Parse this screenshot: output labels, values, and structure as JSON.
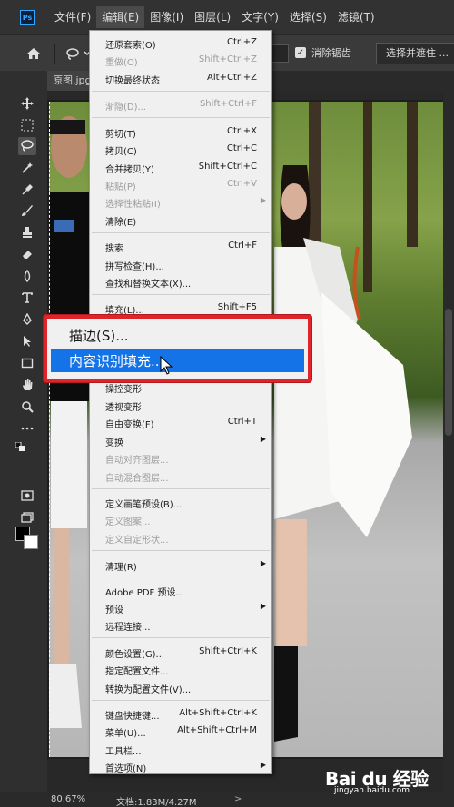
{
  "menubar": {
    "logo": "Ps",
    "items": [
      "文件(F)",
      "编辑(E)",
      "图像(I)",
      "图层(L)",
      "文字(Y)",
      "选择(S)",
      "滤镜(T)"
    ]
  },
  "options": {
    "antialias_label": "消除锯齿",
    "select_mask_label": "选择并遮住 ..."
  },
  "tab": {
    "label": "原图.jpg"
  },
  "status": {
    "zoom": "80.67%",
    "doc": "文档:1.83M/4.27M",
    "arrow": ">"
  },
  "menu": {
    "items": [
      {
        "label": "还原套索(O)",
        "shortcut": "Ctrl+Z",
        "disabled": false
      },
      {
        "label": "重做(O)",
        "shortcut": "Shift+Ctrl+Z",
        "disabled": true
      },
      {
        "label": "切换最终状态",
        "shortcut": "Alt+Ctrl+Z",
        "disabled": false
      },
      {
        "label": "渐隐(D)...",
        "shortcut": "Shift+Ctrl+F",
        "disabled": true
      },
      {
        "label": "剪切(T)",
        "shortcut": "Ctrl+X",
        "disabled": false
      },
      {
        "label": "拷贝(C)",
        "shortcut": "Ctrl+C",
        "disabled": false
      },
      {
        "label": "合并拷贝(Y)",
        "shortcut": "Shift+Ctrl+C",
        "disabled": false
      },
      {
        "label": "粘贴(P)",
        "shortcut": "Ctrl+V",
        "disabled": true
      },
      {
        "label": "选择性粘贴(I)",
        "shortcut": "",
        "disabled": true
      },
      {
        "label": "清除(E)",
        "shortcut": "",
        "disabled": false
      },
      {
        "label": "搜索",
        "shortcut": "Ctrl+F",
        "disabled": false
      },
      {
        "label": "拼写检查(H)...",
        "shortcut": "",
        "disabled": false
      },
      {
        "label": "查找和替换文本(X)...",
        "shortcut": "",
        "disabled": false
      },
      {
        "label": "填充(L)...",
        "shortcut": "Shift+F5",
        "disabled": false
      },
      {
        "label": "描边(S)...",
        "shortcut": "",
        "disabled": false
      },
      {
        "label": "内容识别填充...",
        "shortcut": "",
        "disabled": false
      },
      {
        "label": "操控变形",
        "shortcut": "",
        "disabled": false
      },
      {
        "label": "透视变形",
        "shortcut": "",
        "disabled": false
      },
      {
        "label": "自由变换(F)",
        "shortcut": "Ctrl+T",
        "disabled": false
      },
      {
        "label": "变换",
        "shortcut": "",
        "disabled": false
      },
      {
        "label": "自动对齐图层...",
        "shortcut": "",
        "disabled": true
      },
      {
        "label": "自动混合图层...",
        "shortcut": "",
        "disabled": true
      },
      {
        "label": "定义画笔预设(B)...",
        "shortcut": "",
        "disabled": false
      },
      {
        "label": "定义图案...",
        "shortcut": "",
        "disabled": true
      },
      {
        "label": "定义自定形状...",
        "shortcut": "",
        "disabled": true
      },
      {
        "label": "清理(R)",
        "shortcut": "",
        "disabled": false
      },
      {
        "label": "Adobe PDF 预设...",
        "shortcut": "",
        "disabled": false
      },
      {
        "label": "预设",
        "shortcut": "",
        "disabled": false
      },
      {
        "label": "远程连接...",
        "shortcut": "",
        "disabled": false
      },
      {
        "label": "颜色设置(G)...",
        "shortcut": "Shift+Ctrl+K",
        "disabled": false
      },
      {
        "label": "指定配置文件...",
        "shortcut": "",
        "disabled": false
      },
      {
        "label": "转换为配置文件(V)...",
        "shortcut": "",
        "disabled": false
      },
      {
        "label": "键盘快捷键...",
        "shortcut": "Alt+Shift+Ctrl+K",
        "disabled": false
      },
      {
        "label": "菜单(U)...",
        "shortcut": "Alt+Shift+Ctrl+M",
        "disabled": false
      },
      {
        "label": "工具栏...",
        "shortcut": "",
        "disabled": false
      },
      {
        "label": "首选项(N)",
        "shortcut": "",
        "disabled": false
      }
    ]
  },
  "watermark": {
    "brand": "Bai du 经验",
    "url": "jingyan.baidu.com"
  },
  "colors": {
    "highlight": "#1473e6",
    "callout_border": "#e0242a"
  }
}
